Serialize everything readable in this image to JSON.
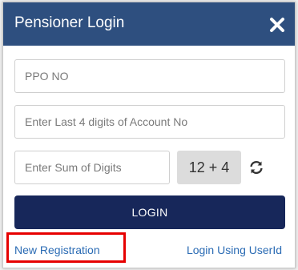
{
  "dialog": {
    "title": "Pensioner Login",
    "close_icon": "close-icon"
  },
  "form": {
    "ppo_placeholder": "PPO NO",
    "account_placeholder": "Enter Last 4 digits of Account No",
    "sum_placeholder": "Enter Sum of Digits",
    "captcha_text": "12 + 4",
    "refresh_icon": "refresh-icon",
    "login_label": "LOGIN"
  },
  "links": {
    "new_registration": "New Registration",
    "login_userid": "Login Using UserId"
  },
  "colors": {
    "header": "#2e4f7f",
    "login_button": "#17275a",
    "link": "#2a6bb4",
    "highlight": "#e60000"
  }
}
